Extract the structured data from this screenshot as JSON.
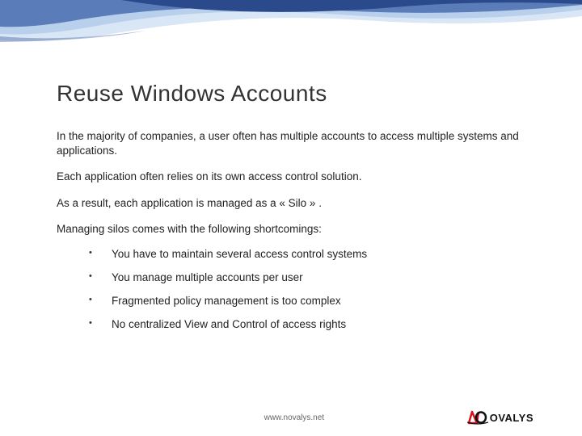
{
  "slide": {
    "title": "Reuse Windows Accounts",
    "paragraphs": [
      "In the majority of companies, a user often has multiple accounts to access multiple systems and applications.",
      "Each application often relies on its own access control solution.",
      "As a result, each application is managed as a « Silo » .",
      "Managing silos comes with the following shortcomings:"
    ],
    "bullets": [
      "You have to maintain several access control systems",
      "You manage multiple accounts per user",
      "Fragmented policy management is too complex",
      "No centralized View and Control of access rights"
    ]
  },
  "footer": {
    "url": "www.novalys.net",
    "logo_text": "OVALYS"
  },
  "colors": {
    "wave_dark": "#2a4a8c",
    "wave_light": "#a8c4e8",
    "logo_red": "#d4141e",
    "logo_black": "#111111"
  }
}
